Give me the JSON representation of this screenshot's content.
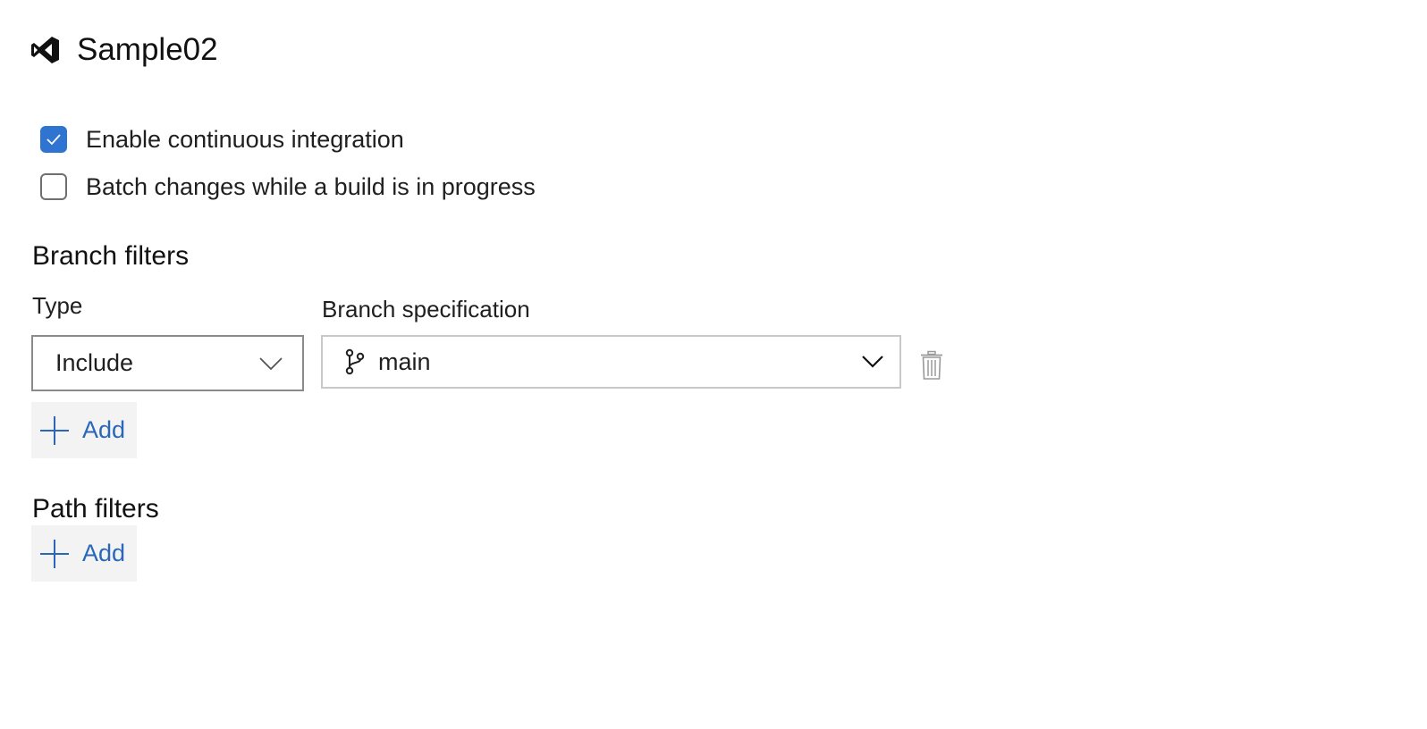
{
  "header": {
    "title": "Sample02",
    "icon": "visual-studio-icon"
  },
  "options": {
    "enable_ci": {
      "label": "Enable continuous integration",
      "checked": true
    },
    "batch_changes": {
      "label": "Batch changes while a build is in progress",
      "checked": false
    }
  },
  "branch_filters": {
    "title": "Branch filters",
    "type_label": "Type",
    "spec_label": "Branch specification",
    "rows": [
      {
        "type": "Include",
        "branch": "main"
      }
    ],
    "add_label": "Add"
  },
  "path_filters": {
    "title": "Path filters",
    "add_label": "Add"
  },
  "colors": {
    "accent": "#2f74d0",
    "link": "#2b67b8",
    "button_bg": "#f3f3f3"
  }
}
